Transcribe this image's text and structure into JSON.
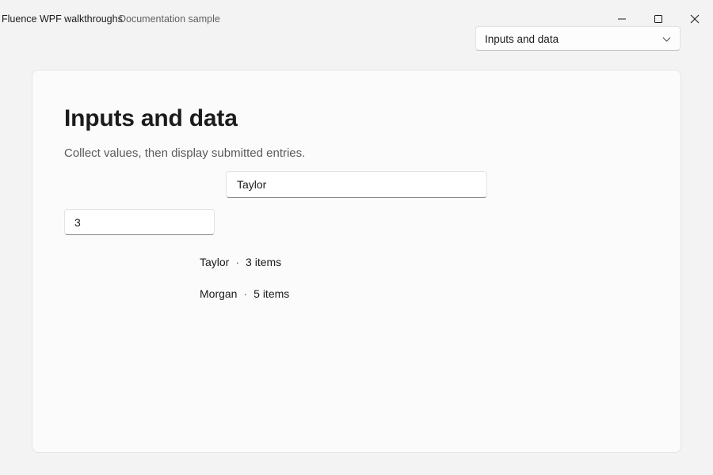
{
  "titlebar": {
    "app_title": "Fluence WPF walkthroughs",
    "app_subtitle": "Documentation sample",
    "icons": {
      "minimize": "minimize-icon",
      "maximize": "maximize-icon",
      "close": "close-icon"
    }
  },
  "page_selector": {
    "selected": "Inputs and data",
    "icon": "chevron-down-icon"
  },
  "page": {
    "title": "Inputs and data",
    "description": "Collect values, then display submitted entries.",
    "name_input_value": "Taylor",
    "quantity_input_value": "3",
    "separator": "·",
    "entries": [
      {
        "name": "Taylor",
        "items": "3 items"
      },
      {
        "name": "Morgan",
        "items": "5 items"
      }
    ]
  },
  "colors": {
    "background": "#f3f3f3",
    "card": "#fbfbfb",
    "text": "#1b1b1b",
    "secondary_text": "#5a5a5a"
  }
}
